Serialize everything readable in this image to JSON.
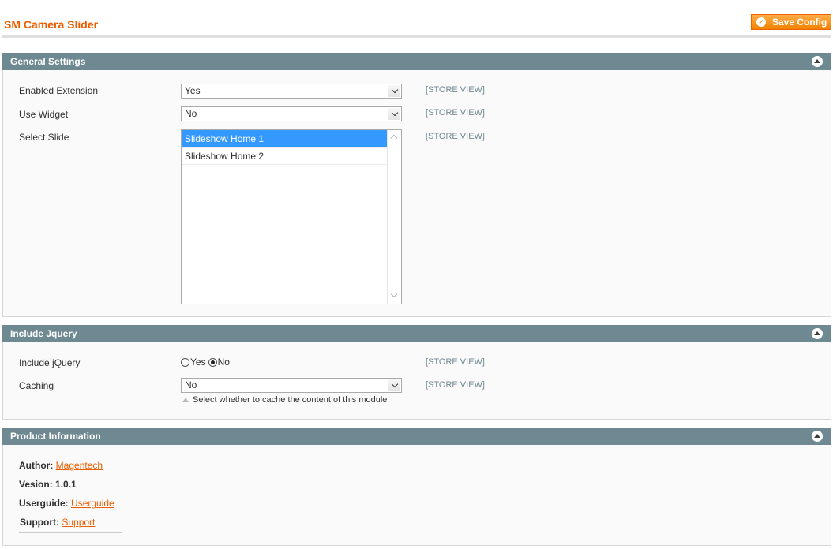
{
  "page": {
    "title": "SM Camera Slider",
    "save_label": "Save Config"
  },
  "general": {
    "title": "General Settings",
    "enabled_label": "Enabled Extension",
    "enabled_value": "Yes",
    "widget_label": "Use Widget",
    "widget_value": "No",
    "slide_label": "Select Slide",
    "slide_options": [
      "Slideshow Home 1",
      "Slideshow Home 2"
    ],
    "scope": "[STORE VIEW]"
  },
  "jquery": {
    "title": "Include Jquery",
    "include_label": "Include jQuery",
    "opt_yes": "Yes",
    "opt_no": "No",
    "caching_label": "Caching",
    "caching_value": "No",
    "caching_note": "Select whether to cache the content of this module",
    "scope": "[STORE VIEW]"
  },
  "product": {
    "title": "Product Information",
    "author_label": "Author:",
    "author_link": "Magentech",
    "version_label": "Vesion:",
    "version_value": "1.0.1",
    "guide_label": "Userguide:",
    "guide_link": "Userguide",
    "support_label": "Support:",
    "support_link": "Support"
  },
  "colors": {
    "accent": "#eb5e00",
    "section_header": "#6f8992",
    "selected": "#3399ff"
  }
}
